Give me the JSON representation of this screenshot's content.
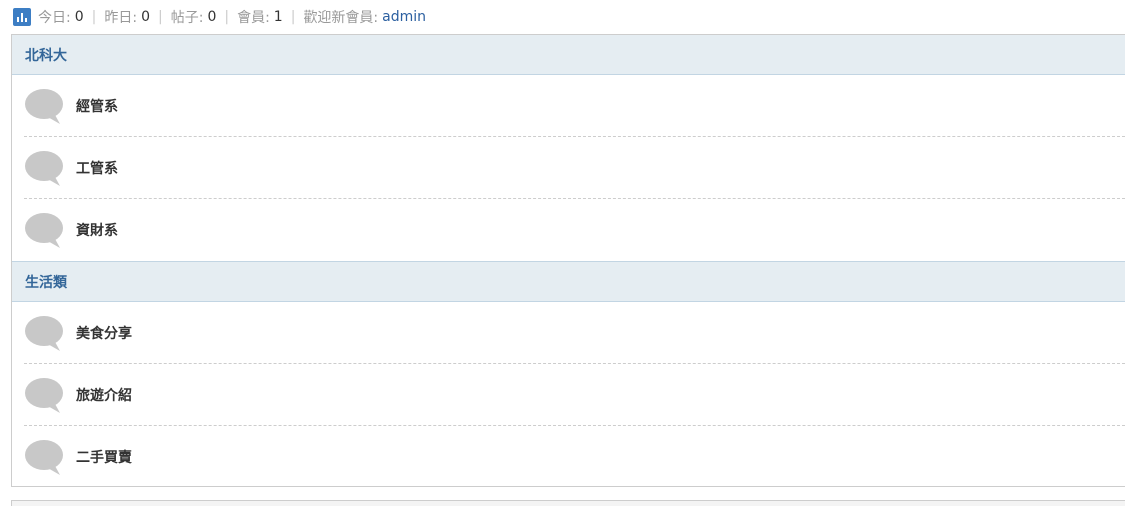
{
  "stats": {
    "today_label": "今日:",
    "today_value": "0",
    "yesterday_label": "昨日:",
    "yesterday_value": "0",
    "posts_label": "帖子:",
    "posts_value": "0",
    "members_label": "會員:",
    "members_value": "1",
    "welcome_label": "歡迎新會員:",
    "welcome_user": "admin",
    "separator": "|"
  },
  "categories": [
    {
      "title": "北科大",
      "forums": [
        {
          "name": "經管系",
          "icon": "speech-bubble-icon"
        },
        {
          "name": "工管系",
          "icon": "speech-bubble-icon"
        },
        {
          "name": "資財系",
          "icon": "speech-bubble-icon"
        }
      ]
    },
    {
      "title": "生活類",
      "forums": [
        {
          "name": "美食分享",
          "icon": "speech-bubble-icon"
        },
        {
          "name": "旅遊介紹",
          "icon": "speech-bubble-icon"
        },
        {
          "name": "二手買賣",
          "icon": "speech-bubble-icon"
        }
      ]
    }
  ],
  "colors": {
    "header_bg": "#e5edf2",
    "header_text": "#336699",
    "icon_gray": "#c8c8c8",
    "stats_icon": "#3d7ec4",
    "link": "#2b5fa0"
  }
}
